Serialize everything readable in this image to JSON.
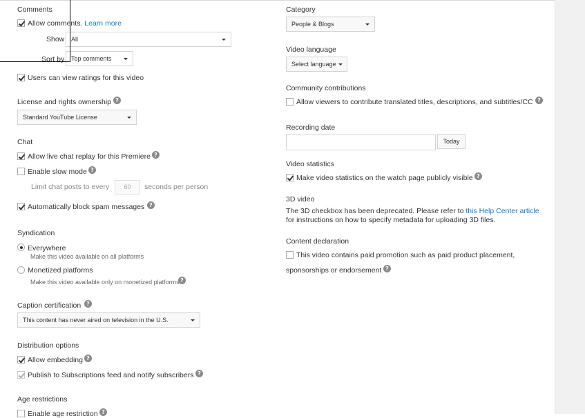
{
  "left": {
    "comments": {
      "title": "Comments",
      "allow_label": "Allow comments.",
      "learn_more": "Learn more",
      "show_label": "Show",
      "show_value": "All",
      "sortby_label": "Sort by",
      "sortby_value": "Top comments",
      "ratings_label": "Users can view ratings for this video"
    },
    "license": {
      "title": "License and rights ownership",
      "value": "Standard YouTube License"
    },
    "chat": {
      "title": "Chat",
      "replay_label": "Allow live chat replay for this Premiere",
      "slow_mode_label": "Enable slow mode",
      "limit_prefix": "Limit chat posts to every",
      "limit_value": "60",
      "limit_suffix": "seconds per person",
      "spam_label": "Automatically block spam messages"
    },
    "syndication": {
      "title": "Syndication",
      "everywhere_label": "Everywhere",
      "everywhere_desc": "Make this video available on all platforms",
      "monetized_label": "Monetized platforms",
      "monetized_desc": "Make this video available only on monetized platforms"
    },
    "caption": {
      "title": "Caption certification",
      "value": "This content has never aired on television in the U.S."
    },
    "distribution": {
      "title": "Distribution options",
      "embed_label": "Allow embedding",
      "publish_label": "Publish to Subscriptions feed and notify subscribers"
    },
    "age": {
      "title": "Age restrictions",
      "enable_label": "Enable age restriction"
    }
  },
  "right": {
    "category": {
      "title": "Category",
      "value": "People & Blogs"
    },
    "language": {
      "title": "Video language",
      "value": "Select language"
    },
    "community": {
      "title": "Community contributions",
      "label": "Allow viewers to contribute translated titles, descriptions, and subtitles/CC"
    },
    "recording": {
      "title": "Recording date",
      "today": "Today",
      "value": ""
    },
    "statistics": {
      "title": "Video statistics",
      "label": "Make video statistics on the watch page publicly visible"
    },
    "video3d": {
      "title": "3D video",
      "text1": "The 3D checkbox has been deprecated. Please refer to",
      "link": "this Help Center article",
      "text2": "for instructions on how to specify metadata for uploading 3D files."
    },
    "content": {
      "title": "Content declaration",
      "line1": "This video contains paid promotion such as paid product placement,",
      "line2": "sponsorships or endorsement"
    }
  },
  "help_glyph": "?",
  "colors": {
    "link": "#167ac6",
    "text": "#333333",
    "muted": "#888888",
    "gutter": "#f1f1f1"
  }
}
